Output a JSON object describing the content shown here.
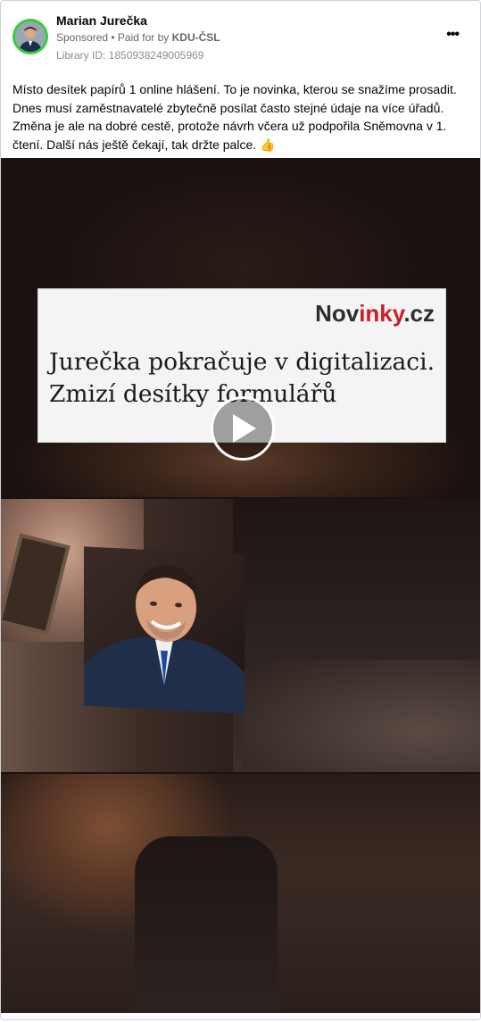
{
  "post": {
    "author": "Marian Jurečka",
    "sponsored": "Sponsored",
    "paid_for_prefix": " • Paid for by ",
    "paid_for": "KDU-ČSL",
    "library_id": "Library ID: 1850938249005969",
    "more_icon": "•••",
    "text": "Místo desítek papírů 1 online hlášení. To je novinka, kterou se snažíme prosadit. Dnes musí zaměstnavatelé zbytečně posílat často stejné údaje na více úřadů. Změna je ale na dobré cestě, protože návrh včera už podpořila Sněmovna v 1. čtení. Další nás ještě čekají, tak držte palce. 👍"
  },
  "media": {
    "brand_prefix": "Nov",
    "brand_accent": "inky",
    "brand_suffix": ".cz",
    "headline_line1": "Jurečka pokračuje v digitalizaci.",
    "headline_line2": "Zmizí desítky formulářů",
    "play_icon": "play-icon"
  },
  "colors": {
    "avatar_ring": "#2fd13b",
    "brand_accent": "#d11c26"
  }
}
